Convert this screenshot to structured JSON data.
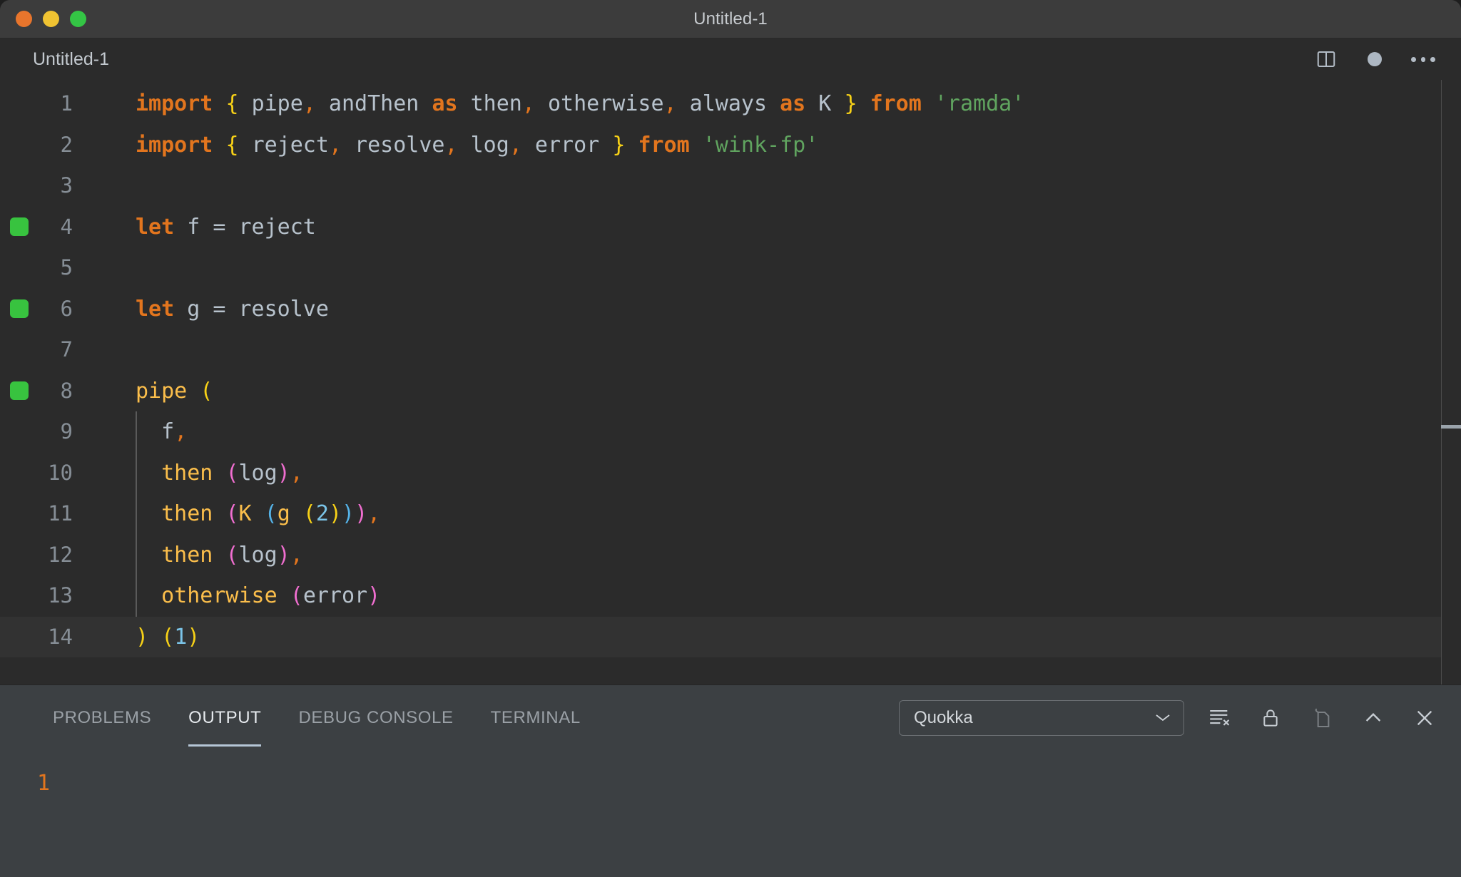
{
  "titlebar": {
    "title": "Untitled-1",
    "buttons": [
      {
        "name": "close",
        "color": "#e8752c"
      },
      {
        "name": "minimize",
        "color": "#f0c332"
      },
      {
        "name": "maximize",
        "color": "#34c545"
      }
    ]
  },
  "editor_tab": {
    "label": "Untitled-1",
    "actions": [
      "split-editor-icon",
      "unsaved-dot-icon",
      "more-actions-icon"
    ]
  },
  "code": {
    "language": "javascript",
    "active_line": 14,
    "lines": [
      {
        "number": "1",
        "marker": false,
        "indent_guide": false,
        "tokens": [
          {
            "t": "import",
            "c": "kw"
          },
          {
            "t": " ",
            "c": "id"
          },
          {
            "t": "{",
            "c": "br-y"
          },
          {
            "t": " ",
            "c": "id"
          },
          {
            "t": "pipe",
            "c": "id"
          },
          {
            "t": ",",
            "c": "op"
          },
          {
            "t": " andThen ",
            "c": "id"
          },
          {
            "t": "as",
            "c": "kw"
          },
          {
            "t": " then",
            "c": "id"
          },
          {
            "t": ",",
            "c": "op"
          },
          {
            "t": " otherwise",
            "c": "id"
          },
          {
            "t": ",",
            "c": "op"
          },
          {
            "t": " always ",
            "c": "id"
          },
          {
            "t": "as",
            "c": "kw"
          },
          {
            "t": " K ",
            "c": "id"
          },
          {
            "t": "}",
            "c": "br-y"
          },
          {
            "t": " ",
            "c": "id"
          },
          {
            "t": "from",
            "c": "kw"
          },
          {
            "t": " ",
            "c": "id"
          },
          {
            "t": "'ramda'",
            "c": "str"
          }
        ]
      },
      {
        "number": "2",
        "marker": false,
        "indent_guide": false,
        "tokens": [
          {
            "t": "import",
            "c": "kw"
          },
          {
            "t": " ",
            "c": "id"
          },
          {
            "t": "{",
            "c": "br-y"
          },
          {
            "t": " ",
            "c": "id"
          },
          {
            "t": "reject",
            "c": "id"
          },
          {
            "t": ",",
            "c": "op"
          },
          {
            "t": " resolve",
            "c": "id"
          },
          {
            "t": ",",
            "c": "op"
          },
          {
            "t": " log",
            "c": "id"
          },
          {
            "t": ",",
            "c": "op"
          },
          {
            "t": " error ",
            "c": "id"
          },
          {
            "t": "}",
            "c": "br-y"
          },
          {
            "t": " ",
            "c": "id"
          },
          {
            "t": "from",
            "c": "kw"
          },
          {
            "t": " ",
            "c": "id"
          },
          {
            "t": "'wink-fp'",
            "c": "str"
          }
        ]
      },
      {
        "number": "3",
        "marker": false,
        "indent_guide": false,
        "tokens": []
      },
      {
        "number": "4",
        "marker": true,
        "indent_guide": false,
        "tokens": [
          {
            "t": "let",
            "c": "kw"
          },
          {
            "t": " f ",
            "c": "id"
          },
          {
            "t": "=",
            "c": "eq"
          },
          {
            "t": " reject",
            "c": "id"
          }
        ]
      },
      {
        "number": "5",
        "marker": false,
        "indent_guide": false,
        "tokens": []
      },
      {
        "number": "6",
        "marker": true,
        "indent_guide": false,
        "tokens": [
          {
            "t": "let",
            "c": "kw"
          },
          {
            "t": " g ",
            "c": "id"
          },
          {
            "t": "=",
            "c": "eq"
          },
          {
            "t": " resolve",
            "c": "id"
          }
        ]
      },
      {
        "number": "7",
        "marker": false,
        "indent_guide": false,
        "tokens": []
      },
      {
        "number": "8",
        "marker": true,
        "indent_guide": false,
        "tokens": [
          {
            "t": "pipe ",
            "c": "fn"
          },
          {
            "t": "(",
            "c": "br-y"
          }
        ]
      },
      {
        "number": "9",
        "marker": false,
        "indent_guide": true,
        "tokens": [
          {
            "t": "  f",
            "c": "id"
          },
          {
            "t": ",",
            "c": "op"
          }
        ]
      },
      {
        "number": "10",
        "marker": false,
        "indent_guide": true,
        "tokens": [
          {
            "t": "  then ",
            "c": "fn"
          },
          {
            "t": "(",
            "c": "br-m"
          },
          {
            "t": "log",
            "c": "id"
          },
          {
            "t": ")",
            "c": "br-m"
          },
          {
            "t": ",",
            "c": "op"
          }
        ]
      },
      {
        "number": "11",
        "marker": false,
        "indent_guide": true,
        "tokens": [
          {
            "t": "  then ",
            "c": "fn"
          },
          {
            "t": "(",
            "c": "br-m"
          },
          {
            "t": "K ",
            "c": "fn"
          },
          {
            "t": "(",
            "c": "br-b"
          },
          {
            "t": "g ",
            "c": "fn"
          },
          {
            "t": "(",
            "c": "br-y"
          },
          {
            "t": "2",
            "c": "num"
          },
          {
            "t": ")",
            "c": "br-y"
          },
          {
            "t": ")",
            "c": "br-b"
          },
          {
            "t": ")",
            "c": "br-m"
          },
          {
            "t": ",",
            "c": "op"
          }
        ]
      },
      {
        "number": "12",
        "marker": false,
        "indent_guide": true,
        "tokens": [
          {
            "t": "  then ",
            "c": "fn"
          },
          {
            "t": "(",
            "c": "br-m"
          },
          {
            "t": "log",
            "c": "id"
          },
          {
            "t": ")",
            "c": "br-m"
          },
          {
            "t": ",",
            "c": "op"
          }
        ]
      },
      {
        "number": "13",
        "marker": false,
        "indent_guide": true,
        "tokens": [
          {
            "t": "  otherwise ",
            "c": "fn"
          },
          {
            "t": "(",
            "c": "br-m"
          },
          {
            "t": "error",
            "c": "id"
          },
          {
            "t": ")",
            "c": "br-m"
          }
        ]
      },
      {
        "number": "14",
        "marker": false,
        "indent_guide": false,
        "tokens": [
          {
            "t": ")",
            "c": "br-y"
          },
          {
            "t": " ",
            "c": "id"
          },
          {
            "t": "(",
            "c": "br-y"
          },
          {
            "t": "1",
            "c": "num"
          },
          {
            "t": ")",
            "c": "br-y"
          }
        ]
      }
    ]
  },
  "panel": {
    "tabs": [
      {
        "label": "PROBLEMS",
        "active": false
      },
      {
        "label": "OUTPUT",
        "active": true
      },
      {
        "label": "DEBUG CONSOLE",
        "active": false
      },
      {
        "label": "TERMINAL",
        "active": false
      }
    ],
    "channel_select": {
      "value": "Quokka",
      "options": [
        "Quokka"
      ]
    },
    "actions": [
      {
        "name": "clear-output-icon",
        "dim": false
      },
      {
        "name": "lock-scroll-icon",
        "dim": false
      },
      {
        "name": "open-in-editor-icon",
        "dim": true
      },
      {
        "name": "maximize-panel-icon",
        "dim": false
      },
      {
        "name": "close-panel-icon",
        "dim": false
      }
    ],
    "output_lines": [
      "1"
    ]
  },
  "colors": {
    "keyword": "#e2751e",
    "function": "#fbbe4b",
    "identifier": "#b7c2cc",
    "string": "#60a45f",
    "number": "#7bc4e8",
    "bracket_yellow": "#f7d117",
    "bracket_magenta": "#f06ed0",
    "bracket_blue": "#55b3e8",
    "marker_green": "#38c33f",
    "output_text": "#e2751e"
  }
}
